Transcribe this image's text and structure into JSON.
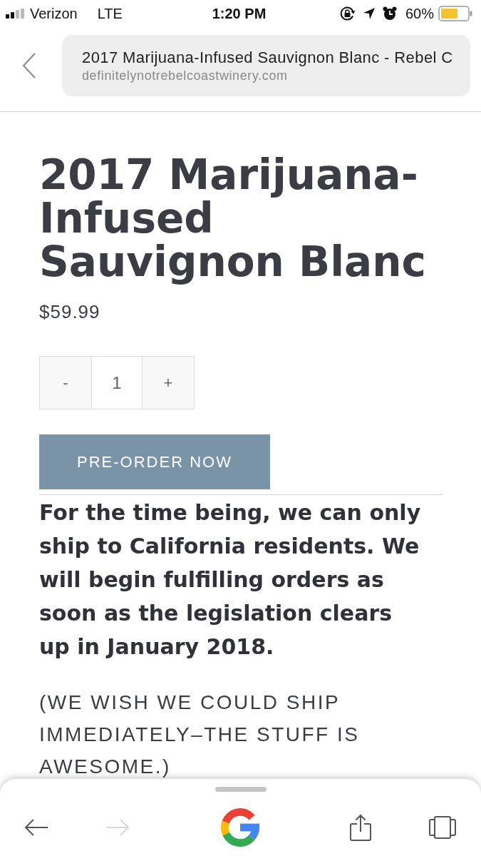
{
  "status_bar": {
    "carrier": "Verizon",
    "network": "LTE",
    "time": "1:20 PM",
    "battery": "60%"
  },
  "address_bar": {
    "title": "2017 Marijuana-Infused Sauvignon Blanc - Rebel C",
    "url": "definitelynotrebelcoastwinery.com"
  },
  "product": {
    "title": "2017 Marijuana-Infused Sauvignon Blanc",
    "price": "$59.99",
    "quantity": {
      "decrement": "-",
      "value": "1",
      "increment": "+"
    },
    "button": "PRE-ORDER NOW",
    "notice": "For the time being, we can only ship to California residents. We will begin fulfilling orders as soon as the legislation clears up in January 2018.",
    "aside": "(WE WISH WE COULD SHIP IMMEDIATELY–THE STUFF IS AWESOME.)"
  },
  "toolbar": [
    {
      "kind": "back",
      "disabled": false
    },
    {
      "kind": "forward",
      "disabled": true
    },
    {
      "kind": "google",
      "disabled": false
    },
    {
      "kind": "share",
      "disabled": false
    },
    {
      "kind": "tabs",
      "disabled": false
    }
  ]
}
